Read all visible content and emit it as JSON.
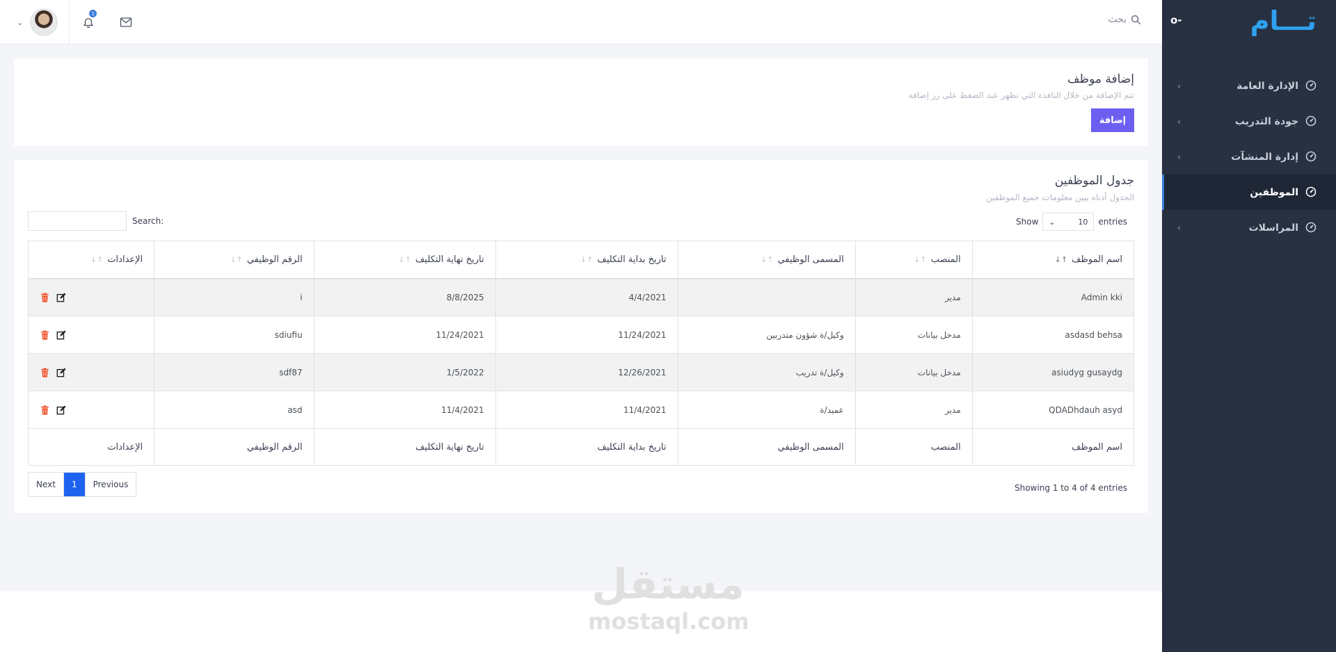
{
  "sidebar": {
    "logo": "تـــام",
    "toggle": "o-",
    "items": [
      {
        "label": "الإدارة العامة",
        "active": false
      },
      {
        "label": "جودة التدريب",
        "active": false
      },
      {
        "label": "إدارة المنشآت",
        "active": false
      },
      {
        "label": "الموظفين",
        "active": true
      },
      {
        "label": "المراسلات",
        "active": false
      }
    ]
  },
  "topbar": {
    "search_label": "بحث",
    "notification_count": "1"
  },
  "add_card": {
    "title": "إضافة موظف",
    "subtitle": "تتم الإضافة من خلال النافذة التي تظهر عند الضغط على زر إضافة",
    "button": "إضافة"
  },
  "table_card": {
    "title": "جدول الموظفين",
    "subtitle": "الجدول أدناه يبين معلومات جميع الموظفين",
    "show_label": "Show",
    "entries_label": "entries",
    "page_length": "10",
    "search_label": "Search:",
    "columns": [
      "اسم الموظف",
      "المنصب",
      "المسمى الوظيفي",
      "تاريخ بداية التكليف",
      "تاريخ نهاية التكليف",
      "الرقم الوظيفي",
      "الإعدادات"
    ],
    "rows": [
      [
        "Admin kki",
        "مدير",
        "",
        "4/4/2021",
        "8/8/2025",
        "i"
      ],
      [
        "asdasd behsa",
        "مدخل بيانات",
        "وكيل/ة شؤون متدربين",
        "11/24/2021",
        "11/24/2021",
        "sdiufiu"
      ],
      [
        "asiudyg gusaydg",
        "مدخل بيانات",
        "وكيل/ة تدريب",
        "12/26/2021",
        "1/5/2022",
        "sdf87"
      ],
      [
        "QDADhdauh asyd",
        "مدير",
        "عميد/ة",
        "11/4/2021",
        "11/4/2021",
        "asd"
      ]
    ],
    "info": "Showing 1 to 4 of 4 entries",
    "pagination": {
      "previous": "Previous",
      "current": "1",
      "next": "Next"
    }
  },
  "watermark": {
    "arabic": "مستقل",
    "latin": "mostaql.com"
  },
  "colors": {
    "sidebar_bg": "#273142",
    "primary_button": "#6c5ff0",
    "page_active": "#1e63f0",
    "delete_icon": "#f0502a",
    "logo": "#2ea0f0"
  }
}
